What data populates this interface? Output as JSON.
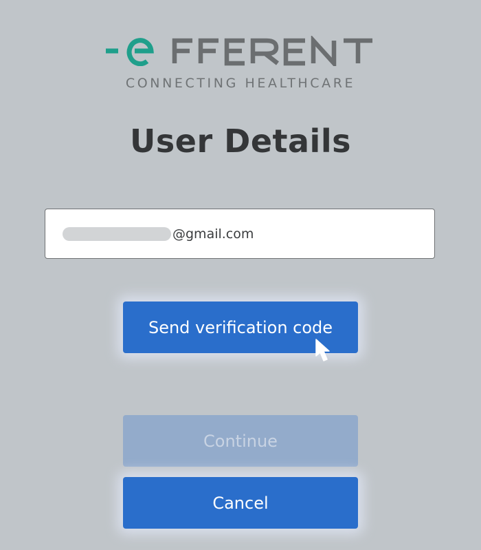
{
  "logo": {
    "wordmark": "eFFERENT",
    "tagline": "CONNECTING HEALTHCARE",
    "accent_color": "#1f9f8b",
    "text_color": "#6b6e70"
  },
  "page": {
    "title": "User Details"
  },
  "email_field": {
    "value_suffix": "@gmail.com",
    "redacted": true
  },
  "buttons": {
    "send_code": "Send verification code",
    "continue": "Continue",
    "cancel": "Cancel"
  },
  "colors": {
    "background": "#c0c5c9",
    "primary_button": "#2a6ecb",
    "disabled_button": "#93abcb"
  },
  "cursor": {
    "icon": "mouse-pointer-icon"
  }
}
